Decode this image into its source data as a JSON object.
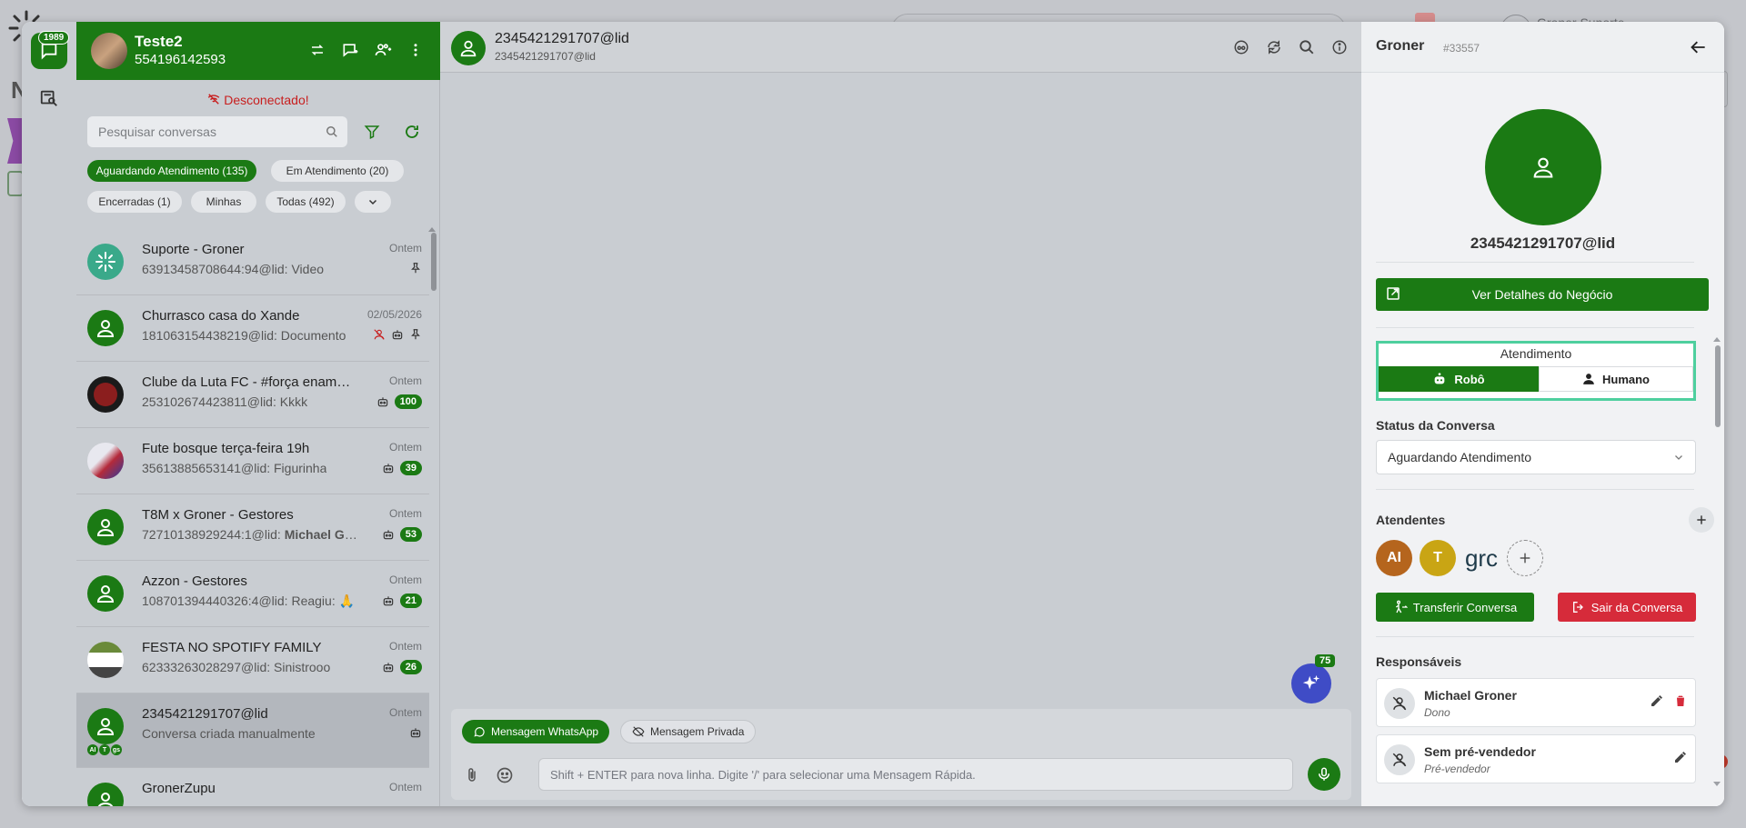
{
  "colors": {
    "brand_green": "#1b7a14",
    "danger": "#d62b3a",
    "highlight": "#4ecf9e",
    "ai_fab": "#3f4cc6"
  },
  "background": {
    "user_label": "Groner Suporte"
  },
  "rail": {
    "badge": "1989"
  },
  "profile": {
    "name": "Teste2",
    "phone": "554196142593"
  },
  "list": {
    "disconnected": "Desconectado!",
    "search_placeholder": "Pesquisar conversas",
    "chips": [
      "Aguardando Atendimento (135)",
      "Em Atendimento (20)",
      "Encerradas (1)",
      "Minhas",
      "Todas (492)"
    ],
    "conversations": [
      {
        "name": "Suporte - Groner",
        "preview": "63913458708644:94@lid: Video",
        "time": "Ontem",
        "badge": ""
      },
      {
        "name": "Churrasco casa do Xande",
        "preview": "181063154438219@lid: Documento",
        "time": "02/05/2026",
        "badge": ""
      },
      {
        "name": "Clube da Luta FC - #força enamorada",
        "preview": "253102674423811@lid: Kkkk",
        "time": "Ontem",
        "badge": "100"
      },
      {
        "name": "Fute bosque terça-feira 19h",
        "preview": "35613885653141@lid: Figurinha",
        "time": "Ontem",
        "badge": "39"
      },
      {
        "name": "T8M x Groner - Gestores",
        "preview_prefix": "72710138929244:1@lid: ",
        "preview_bold": "Michael Groner",
        "time": "Ontem",
        "badge": "53"
      },
      {
        "name": "Azzon - Gestores",
        "preview": "108701394440326:4@lid: Reagiu: 🙏",
        "time": "Ontem",
        "badge": "21"
      },
      {
        "name": "FESTA NO SPOTIFY FAMILY",
        "preview": "62333263028297@lid: Sinistrooo",
        "time": "Ontem",
        "badge": "26"
      },
      {
        "name": "2345421291707@lid",
        "preview": "Conversa criada manualmente",
        "time": "Ontem",
        "badge": ""
      },
      {
        "name": "GronerZupu",
        "preview": "",
        "time": "Ontem",
        "badge": ""
      }
    ],
    "mini_tags": [
      "AI",
      "T",
      "gs"
    ]
  },
  "chat": {
    "title": "2345421291707@lid",
    "subtitle": "2345421291707@lid",
    "ai_badge": "75",
    "tab_whatsapp": "Mensagem WhatsApp",
    "tab_private": "Mensagem Privada",
    "input_placeholder": "Shift + ENTER para nova linha. Digite '/' para selecionar uma Mensagem Rápida."
  },
  "panel": {
    "title": "Groner",
    "id": "#33557",
    "contact_name": "2345421291707@lid",
    "details_button": "Ver Detalhes do Negócio",
    "atendimento_title": "Atendimento",
    "robo": "Robô",
    "humano": "Humano",
    "status_label": "Status da Conversa",
    "status_value": "Aguardando Atendimento",
    "attendants_label": "Atendentes",
    "attendants": [
      {
        "initials": "AI",
        "color": "#b5651d"
      },
      {
        "initials": "T",
        "color": "#c9a514"
      }
    ],
    "attendant_logo": "grc",
    "transfer_button": "Transferir Conversa",
    "leave_button": "Sair da Conversa",
    "responsaveis_label": "Responsáveis",
    "responsaveis": [
      {
        "name": "Michael Groner",
        "role": "Dono"
      },
      {
        "name": "Sem pré-vendedor",
        "role": "Pré-vendedor"
      }
    ]
  }
}
